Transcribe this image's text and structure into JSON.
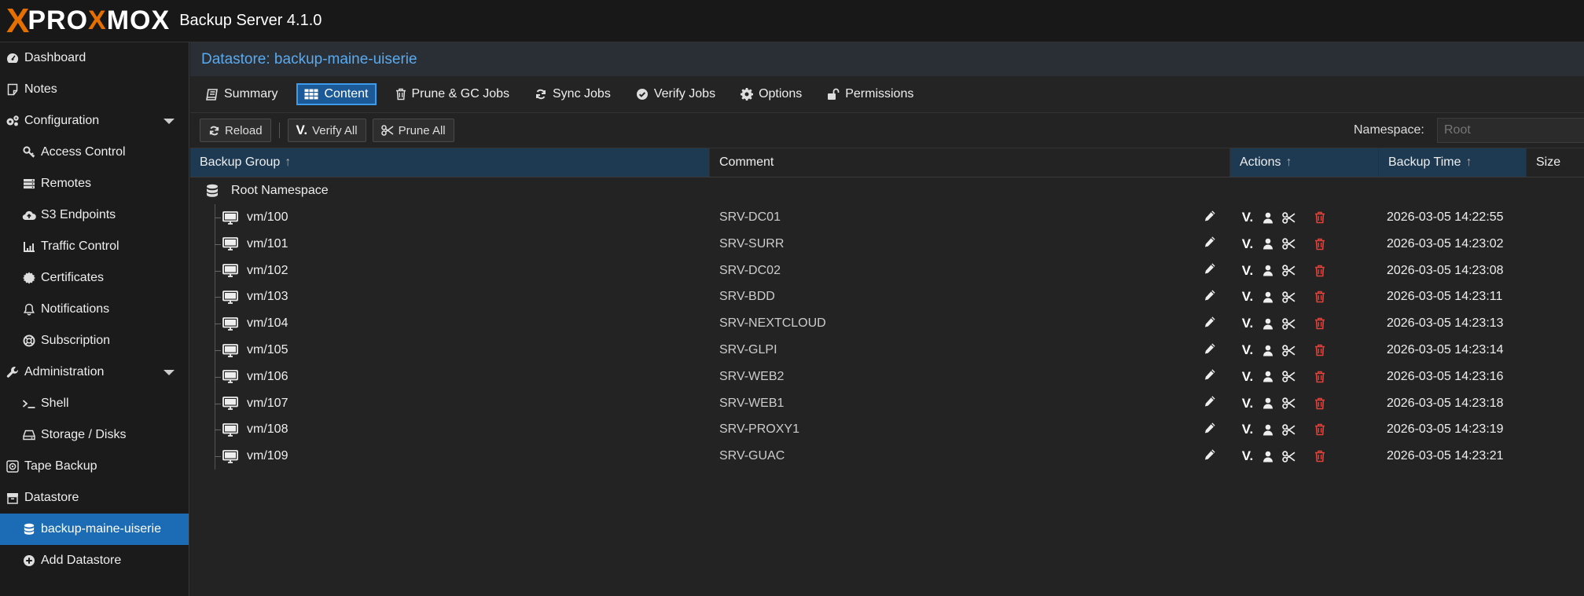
{
  "app": {
    "logo_x": "X",
    "logo_text_pre": "PRO",
    "logo_text_x": "X",
    "logo_text_post": "MOX",
    "title": "Backup Server 4.1.0"
  },
  "sidebar": {
    "items": [
      {
        "label": "Dashboard",
        "icon": "dashboard-icon",
        "level": 0
      },
      {
        "label": "Notes",
        "icon": "notes-icon",
        "level": 0
      },
      {
        "label": "Configuration",
        "icon": "gears-icon",
        "level": 0,
        "expandable": true
      },
      {
        "label": "Access Control",
        "icon": "key-icon",
        "level": 1
      },
      {
        "label": "Remotes",
        "icon": "server-icon",
        "level": 1
      },
      {
        "label": "S3 Endpoints",
        "icon": "cloud-upload-icon",
        "level": 1
      },
      {
        "label": "Traffic Control",
        "icon": "signal-icon",
        "level": 1
      },
      {
        "label": "Certificates",
        "icon": "certificate-icon",
        "level": 1
      },
      {
        "label": "Notifications",
        "icon": "bell-icon",
        "level": 1
      },
      {
        "label": "Subscription",
        "icon": "support-icon",
        "level": 1
      },
      {
        "label": "Administration",
        "icon": "wrench-icon",
        "level": 0,
        "expandable": true
      },
      {
        "label": "Shell",
        "icon": "terminal-icon",
        "level": 1
      },
      {
        "label": "Storage / Disks",
        "icon": "hdd-icon",
        "level": 1
      },
      {
        "label": "Tape Backup",
        "icon": "tape-icon",
        "level": 0
      },
      {
        "label": "Datastore",
        "icon": "archive-icon",
        "level": 0
      },
      {
        "label": "backup-maine-uiserie",
        "icon": "database-icon",
        "level": 1,
        "active": true
      },
      {
        "label": "Add Datastore",
        "icon": "plus-circle-icon",
        "level": 1
      }
    ]
  },
  "datastore": {
    "header": "Datastore: backup-maine-uiserie"
  },
  "tabs": [
    {
      "label": "Summary",
      "icon": "book-icon"
    },
    {
      "label": "Content",
      "icon": "th-icon",
      "active": true
    },
    {
      "label": "Prune & GC Jobs",
      "icon": "trash-icon"
    },
    {
      "label": "Sync Jobs",
      "icon": "refresh-icon"
    },
    {
      "label": "Verify Jobs",
      "icon": "check-circle-icon"
    },
    {
      "label": "Options",
      "icon": "gear-icon"
    },
    {
      "label": "Permissions",
      "icon": "unlock-icon"
    }
  ],
  "toolbar": {
    "reload_label": "Reload",
    "verify_all_label": "Verify All",
    "prune_all_label": "Prune All",
    "namespace_label": "Namespace:",
    "namespace_placeholder": "Root"
  },
  "grid": {
    "columns": {
      "group": "Backup Group",
      "comment": "Comment",
      "actions": "Actions",
      "time": "Backup Time",
      "size": "Size"
    },
    "root_label": "Root Namespace",
    "rows": [
      {
        "group": "vm/100",
        "comment": "SRV-DC01",
        "time": "2026-03-05 14:22:55"
      },
      {
        "group": "vm/101",
        "comment": "SRV-SURR",
        "time": "2026-03-05 14:23:02"
      },
      {
        "group": "vm/102",
        "comment": "SRV-DC02",
        "time": "2026-03-05 14:23:08"
      },
      {
        "group": "vm/103",
        "comment": "SRV-BDD",
        "time": "2026-03-05 14:23:11"
      },
      {
        "group": "vm/104",
        "comment": "SRV-NEXTCLOUD",
        "time": "2026-03-05 14:23:13"
      },
      {
        "group": "vm/105",
        "comment": "SRV-GLPI",
        "time": "2026-03-05 14:23:14"
      },
      {
        "group": "vm/106",
        "comment": "SRV-WEB2",
        "time": "2026-03-05 14:23:16"
      },
      {
        "group": "vm/107",
        "comment": "SRV-WEB1",
        "time": "2026-03-05 14:23:18"
      },
      {
        "group": "vm/108",
        "comment": "SRV-PROXY1",
        "time": "2026-03-05 14:23:19"
      },
      {
        "group": "vm/109",
        "comment": "SRV-GUAC",
        "time": "2026-03-05 14:23:21"
      }
    ],
    "verify_action_text": "V."
  },
  "colors": {
    "accent": "#1c6cb5",
    "header_link": "#5aaaf0",
    "logo_orange": "#e57000",
    "delete_red": "#e0413a"
  }
}
